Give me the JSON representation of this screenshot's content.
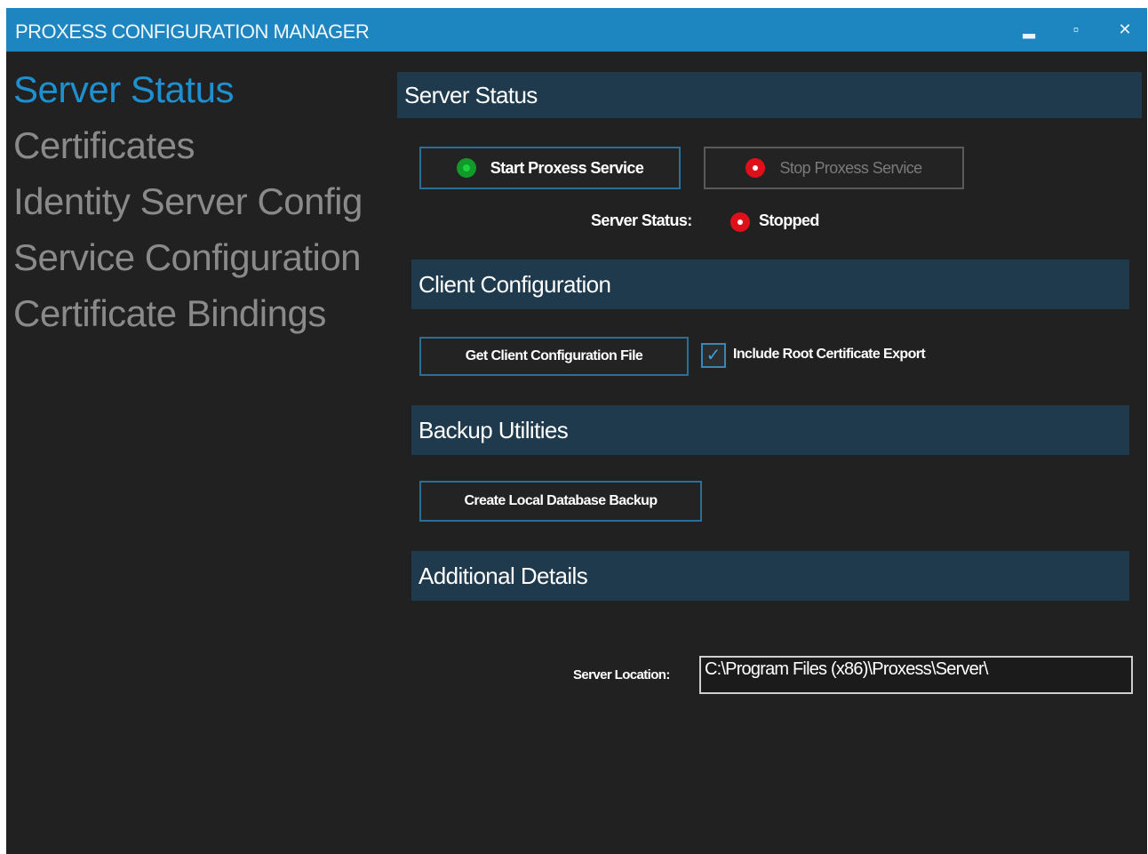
{
  "window": {
    "title": "PROXESS CONFIGURATION MANAGER",
    "minimize_glyph": "▂",
    "maximize_glyph": "▫",
    "close_glyph": "✕"
  },
  "nav": {
    "items": [
      {
        "label": "Server Status",
        "active": true
      },
      {
        "label": "Certificates",
        "active": false
      },
      {
        "label": "Identity Server Config",
        "active": false
      },
      {
        "label": "Service Configuration",
        "active": false
      },
      {
        "label": "Certificate Bindings",
        "active": false
      }
    ]
  },
  "server_status": {
    "header": "Server Status",
    "start_label": "Start Proxess Service",
    "stop_label": "Stop Proxess Service",
    "status_label": "Server Status:",
    "status_value": "Stopped"
  },
  "client_config": {
    "header": "Client Configuration",
    "get_file_label": "Get Client Configuration File",
    "include_root_label": "Include Root Certificate Export",
    "include_root_checked": true
  },
  "backup": {
    "header": "Backup Utilities",
    "create_backup_label": "Create Local Database Backup"
  },
  "additional": {
    "header": "Additional Details",
    "server_location_label": "Server Location:",
    "server_location_value": "C:\\Program Files (x86)\\Proxess\\Server\\"
  },
  "colors": {
    "titlebar": "#1d86c0",
    "background": "#212121",
    "accent": "#1e8fcf",
    "section_header": "#1f3a4c",
    "status_running": "#0f9a2a",
    "status_stopped": "#e0101a"
  }
}
